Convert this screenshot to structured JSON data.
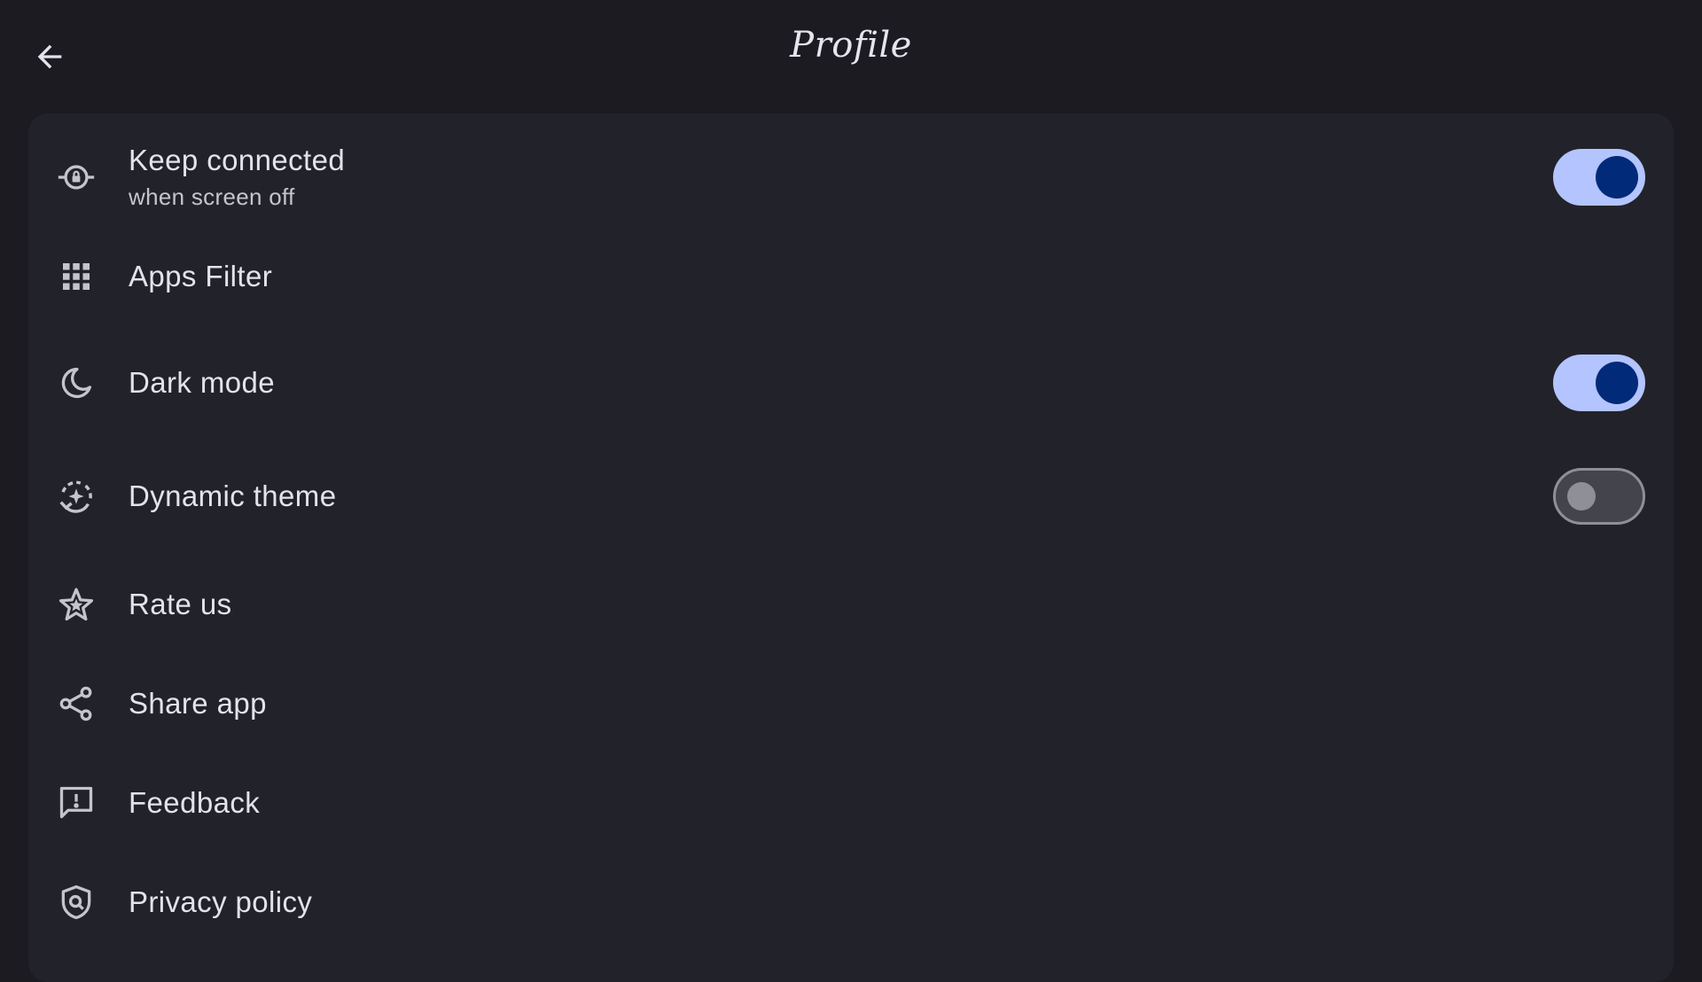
{
  "header": {
    "title": "Profile",
    "back_icon": "arrow-back-icon"
  },
  "colors": {
    "background": "#1b1b21",
    "card": "#22232a",
    "switch_on_track": "#b3c4ff",
    "switch_on_thumb": "#012a78",
    "switch_off_track": "#43444c",
    "switch_off_thumb": "#8e8f98",
    "text_primary": "#e4e2ea",
    "text_secondary": "#c5c4cd"
  },
  "settings": {
    "keep_connected": {
      "label": "Keep connected",
      "sublabel": "when screen off",
      "icon": "lock-vpn-icon",
      "enabled": true
    },
    "apps_filter": {
      "label": "Apps Filter",
      "icon": "apps-grid-icon"
    },
    "dark_mode": {
      "label": "Dark mode",
      "icon": "moon-icon",
      "enabled": true
    },
    "dynamic_theme": {
      "label": "Dynamic theme",
      "icon": "dynamic-sparkle-icon",
      "enabled": false
    },
    "rate_us": {
      "label": "Rate us",
      "icon": "star-icon"
    },
    "share_app": {
      "label": "Share app",
      "icon": "share-icon"
    },
    "feedback": {
      "label": "Feedback",
      "icon": "feedback-icon"
    },
    "privacy_policy": {
      "label": "Privacy policy",
      "icon": "privacy-shield-icon"
    }
  }
}
